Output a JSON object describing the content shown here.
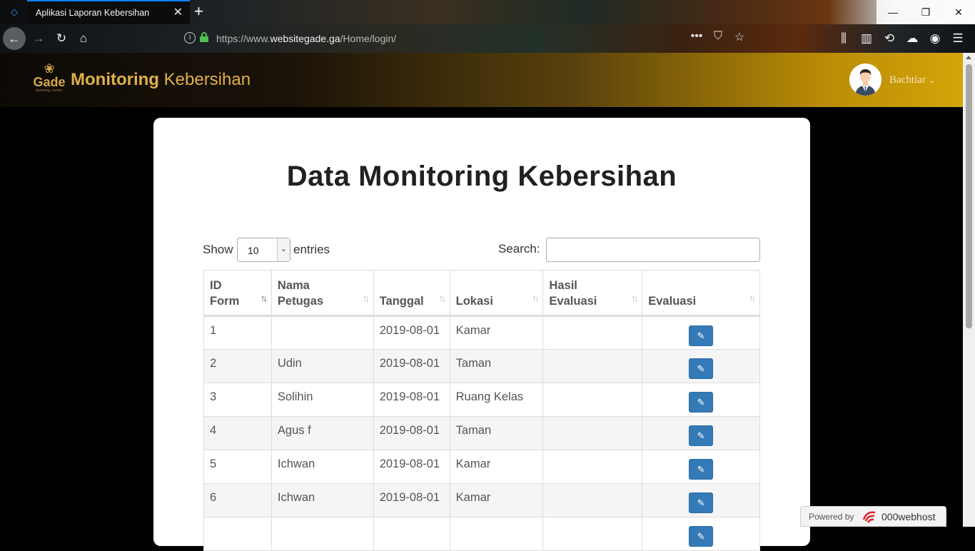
{
  "browser": {
    "tab_title": "Aplikasi Laporan Kebersihan",
    "url_prefix": "https://www.",
    "url_domain": "websitegade.ga",
    "url_path": "/Home/login/"
  },
  "header": {
    "logo_text": "Gade",
    "logo_sub": "learning center",
    "brand_bold": "Monitoring",
    "brand_light": "Kebersihan",
    "username": "Bachtiar"
  },
  "page": {
    "title": "Data Monitoring Kebersihan",
    "show_label": "Show",
    "entries_value": "10",
    "entries_label": "entries",
    "search_label": "Search:",
    "search_value": ""
  },
  "table": {
    "columns": [
      {
        "l1": "ID",
        "l2": "Form"
      },
      {
        "l1": "Nama",
        "l2": "Petugas"
      },
      {
        "l1": "",
        "l2": "Tanggal"
      },
      {
        "l1": "",
        "l2": "Lokasi"
      },
      {
        "l1": "Hasil",
        "l2": "Evaluasi"
      },
      {
        "l1": "",
        "l2": "Evaluasi"
      }
    ],
    "rows": [
      {
        "id": "1",
        "nama": "",
        "tanggal": "2019-08-01",
        "lokasi": "Kamar",
        "hasil": ""
      },
      {
        "id": "2",
        "nama": "Udin",
        "tanggal": "2019-08-01",
        "lokasi": "Taman",
        "hasil": ""
      },
      {
        "id": "3",
        "nama": "Solihin",
        "tanggal": "2019-08-01",
        "lokasi": "Ruang Kelas",
        "hasil": ""
      },
      {
        "id": "4",
        "nama": "Agus f",
        "tanggal": "2019-08-01",
        "lokasi": "Taman",
        "hasil": ""
      },
      {
        "id": "5",
        "nama": "Ichwan",
        "tanggal": "2019-08-01",
        "lokasi": "Kamar",
        "hasil": ""
      },
      {
        "id": "6",
        "nama": "Ichwan",
        "tanggal": "2019-08-01",
        "lokasi": "Kamar",
        "hasil": ""
      },
      {
        "id": "",
        "nama": "",
        "tanggal": "",
        "lokasi": "",
        "hasil": ""
      }
    ]
  },
  "footer_badge": {
    "powered_label": "Powered by",
    "brand": "000webhost"
  },
  "colors": {
    "accent_gold": "#e0b049",
    "edit_button": "#337ab7",
    "url_lock": "#4ec253"
  }
}
